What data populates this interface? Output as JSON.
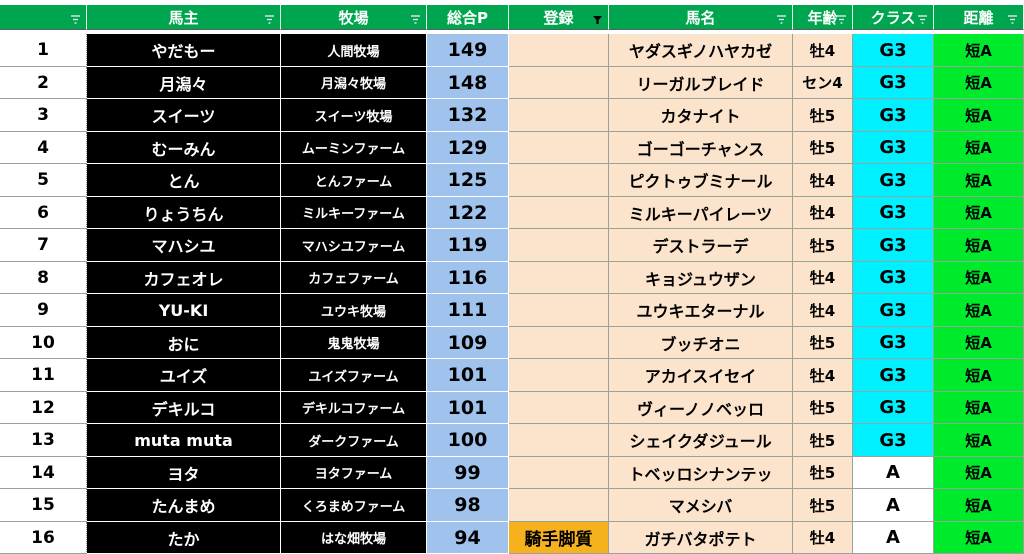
{
  "colors": {
    "header_bg": "#00a64f",
    "owner_bg": "#000000",
    "points_bg": "#9fc3ec",
    "entry_bg": "#fbe3cc",
    "entry_tag_bg": "#f6b21c",
    "class_g3_bg": "#00f0ff",
    "class_a_bg": "#ffffff",
    "distance_bg": "#00ea2c"
  },
  "filter_icon": "filter-dropdown-icon",
  "header": {
    "rank": "",
    "owner": "馬主",
    "ranch": "牧場",
    "points": "総合P",
    "entry": "登録",
    "horse": "馬名",
    "age": "年齢",
    "class": "クラス",
    "distance": "距離"
  },
  "rows": [
    {
      "rank": "1",
      "owner": "やだもー",
      "ranch": "人間牧場",
      "points": "149",
      "entry": "",
      "horse": "ヤダスギノハヤカゼ",
      "age": "牡4",
      "class": "G3",
      "distance": "短A"
    },
    {
      "rank": "2",
      "owner": "月潟々",
      "ranch": "月潟々牧場",
      "points": "148",
      "entry": "",
      "horse": "リーガルブレイド",
      "age": "セン4",
      "class": "G3",
      "distance": "短A"
    },
    {
      "rank": "3",
      "owner": "スイーツ",
      "ranch": "スイーツ牧場",
      "points": "132",
      "entry": "",
      "horse": "カタナイト",
      "age": "牡5",
      "class": "G3",
      "distance": "短A"
    },
    {
      "rank": "4",
      "owner": "むーみん",
      "ranch": "ムーミンファーム",
      "points": "129",
      "entry": "",
      "horse": "ゴーゴーチャンス",
      "age": "牡5",
      "class": "G3",
      "distance": "短A"
    },
    {
      "rank": "5",
      "owner": "とん",
      "ranch": "とんファーム",
      "points": "125",
      "entry": "",
      "horse": "ピクトゥブミナール",
      "age": "牡4",
      "class": "G3",
      "distance": "短A"
    },
    {
      "rank": "6",
      "owner": "りょうちん",
      "ranch": "ミルキーファーム",
      "points": "122",
      "entry": "",
      "horse": "ミルキーパイレーツ",
      "age": "牡4",
      "class": "G3",
      "distance": "短A"
    },
    {
      "rank": "7",
      "owner": "マハシユ",
      "ranch": "マハシユファーム",
      "points": "119",
      "entry": "",
      "horse": "デストラーデ",
      "age": "牡5",
      "class": "G3",
      "distance": "短A"
    },
    {
      "rank": "8",
      "owner": "カフェオレ",
      "ranch": "カフェファーム",
      "points": "116",
      "entry": "",
      "horse": "キョジュウザン",
      "age": "牡4",
      "class": "G3",
      "distance": "短A"
    },
    {
      "rank": "9",
      "owner": "YU-KI",
      "ranch": "ユウキ牧場",
      "points": "111",
      "entry": "",
      "horse": "ユウキエターナル",
      "age": "牡4",
      "class": "G3",
      "distance": "短A"
    },
    {
      "rank": "10",
      "owner": "おに",
      "ranch": "鬼鬼牧場",
      "points": "109",
      "entry": "",
      "horse": "ブッチオニ",
      "age": "牡5",
      "class": "G3",
      "distance": "短A"
    },
    {
      "rank": "11",
      "owner": "ユイズ",
      "ranch": "ユイズファーム",
      "points": "101",
      "entry": "",
      "horse": "アカイスイセイ",
      "age": "牡4",
      "class": "G3",
      "distance": "短A"
    },
    {
      "rank": "12",
      "owner": "デキルコ",
      "ranch": "デキルコファーム",
      "points": "101",
      "entry": "",
      "horse": "ヴィーノノベッロ",
      "age": "牡5",
      "class": "G3",
      "distance": "短A"
    },
    {
      "rank": "13",
      "owner": "muta muta",
      "ranch": "ダークファーム",
      "points": "100",
      "entry": "",
      "horse": "シェイクダジュール",
      "age": "牡5",
      "class": "G3",
      "distance": "短A"
    },
    {
      "rank": "14",
      "owner": "ヨタ",
      "ranch": "ヨタファーム",
      "points": "99",
      "entry": "",
      "horse": "トベッロシナンテッ",
      "age": "牡5",
      "class": "A",
      "distance": "短A"
    },
    {
      "rank": "15",
      "owner": "たんまめ",
      "ranch": "くろまめファーム",
      "points": "98",
      "entry": "",
      "horse": "マメシバ",
      "age": "牡5",
      "class": "A",
      "distance": "短A"
    },
    {
      "rank": "16",
      "owner": "たか",
      "ranch": "はな畑牧場",
      "points": "94",
      "entry": "騎手脚質",
      "horse": "ガチバタポテト",
      "age": "牡4",
      "class": "A",
      "distance": "短A"
    }
  ]
}
